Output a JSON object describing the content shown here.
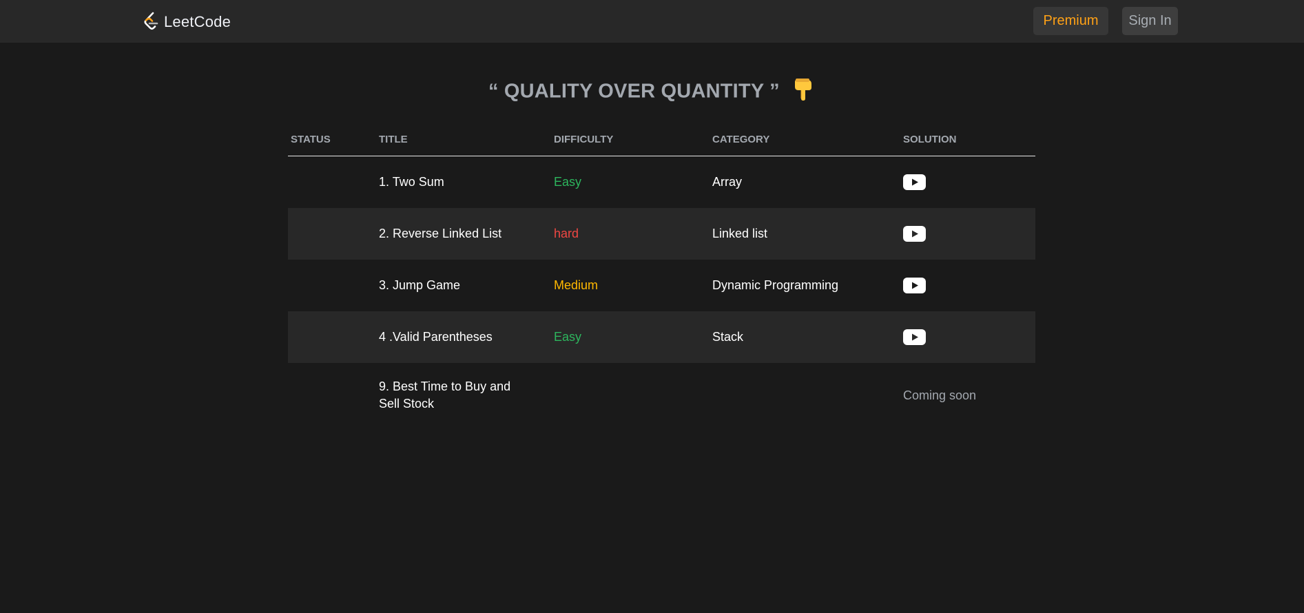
{
  "navbar": {
    "logo_text": "LeetCode",
    "premium_label": "Premium",
    "signin_label": "Sign In"
  },
  "heading": {
    "text": "“ QUALITY OVER QUANTITY ”",
    "emoji": "👇",
    "emoji_icon": "backhand-index-pointing-down-icon"
  },
  "table": {
    "headers": [
      "STATUS",
      "TITLE",
      "DIFFICULTY",
      "CATEGORY",
      "SOLUTION"
    ],
    "rows": [
      {
        "status": "",
        "title": "1. Two Sum",
        "difficulty": "Easy",
        "category": "Array",
        "solution": "youtube-icon"
      },
      {
        "status": "",
        "title": "2. Reverse Linked List",
        "difficulty": "hard",
        "category": "Linked list",
        "solution": "youtube-icon"
      },
      {
        "status": "",
        "title": "3. Jump Game",
        "difficulty": "Medium",
        "category": "Dynamic Programming",
        "solution": "youtube-icon"
      },
      {
        "status": "",
        "title": "4 .Valid Parentheses",
        "difficulty": "Easy",
        "category": "Stack",
        "solution": "youtube-icon"
      },
      {
        "status": "",
        "title": "9. Best Time to Buy and Sell Stock",
        "difficulty": "",
        "category": "",
        "solution_text": "Coming soon"
      }
    ]
  },
  "colors": {
    "background": "#1a1a1a",
    "navbar": "#282828",
    "accent_premium": "#ffa116",
    "easy": "#2db55d",
    "medium": "#ffb800",
    "hard": "#ef4743"
  }
}
